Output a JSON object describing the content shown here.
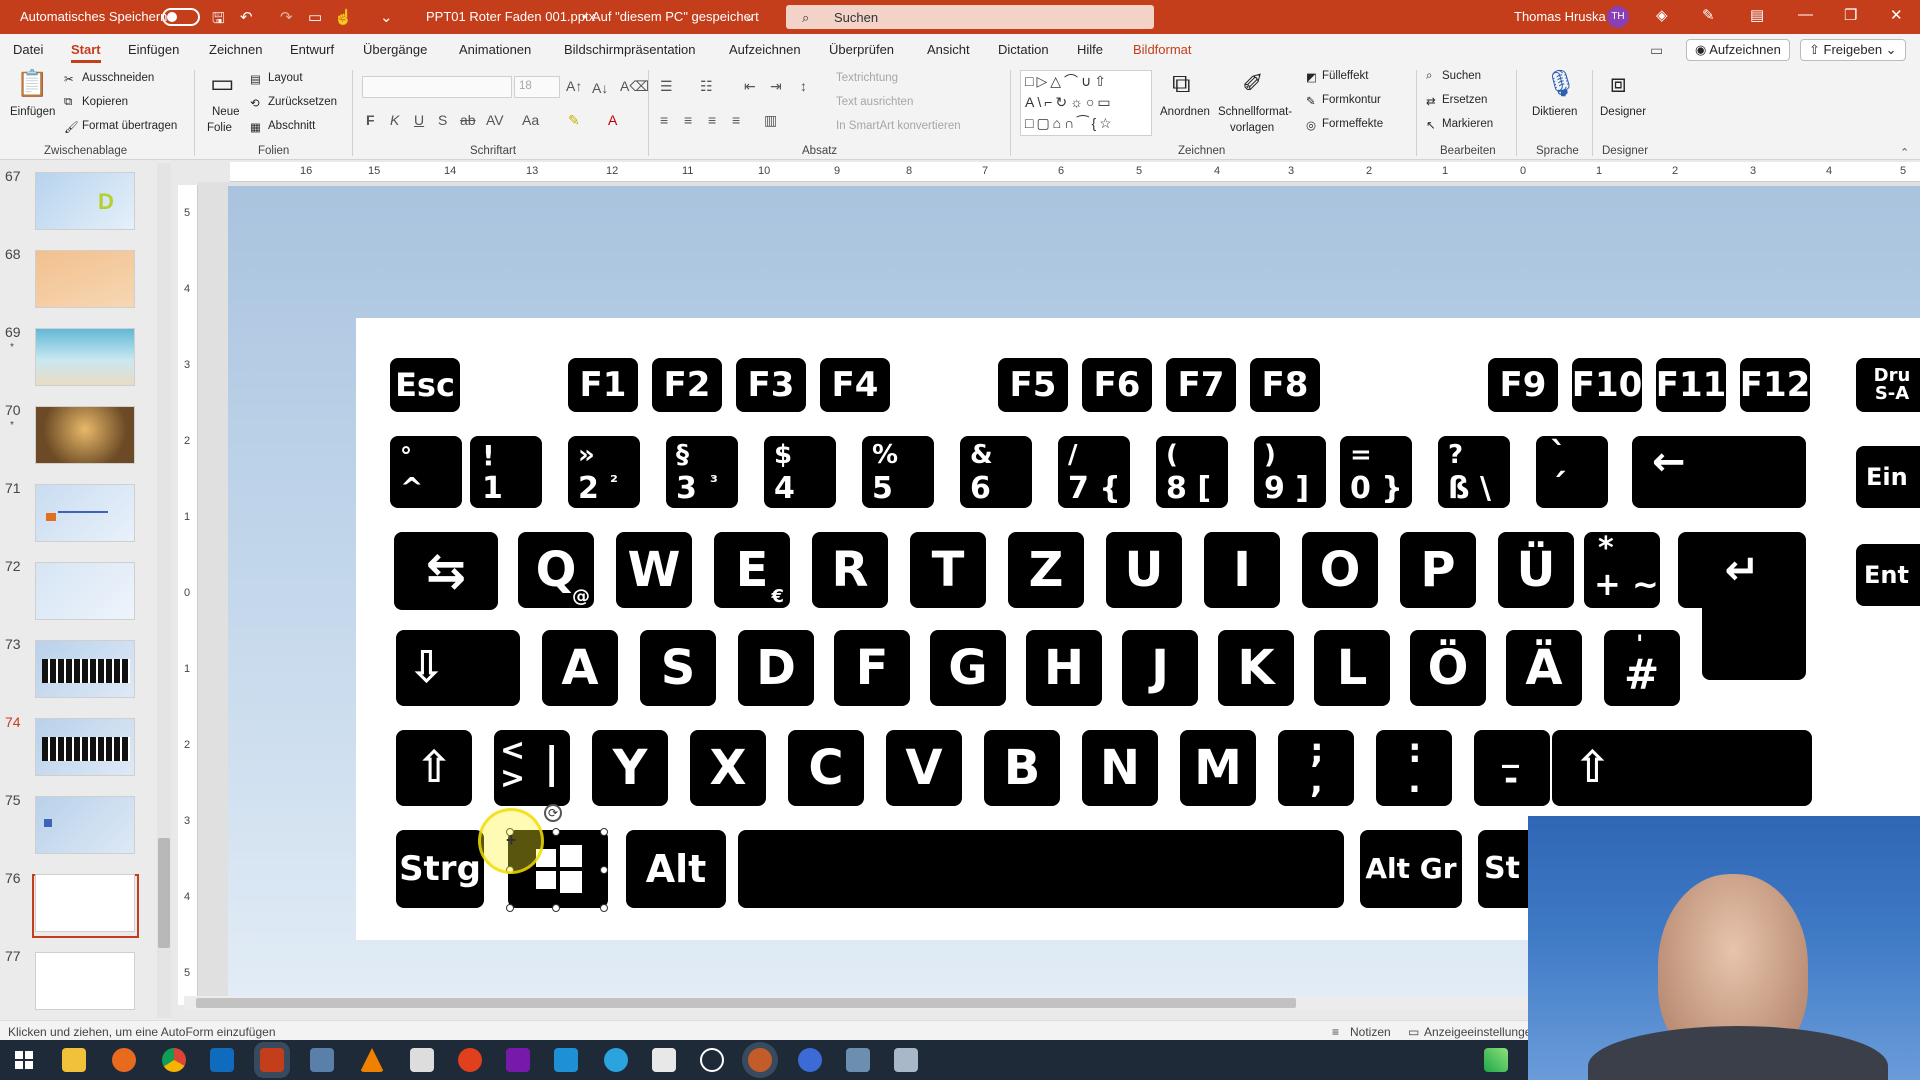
{
  "titlebar": {
    "autosave_label": "Automatisches Speichern",
    "document_title": "PPT01 Roter Faden 001.pptx",
    "save_location": "Auf \"diesem PC\" gespeichert",
    "search_placeholder": "Suchen",
    "user_name": "Thomas Hruska",
    "user_initials": "TH"
  },
  "menu": {
    "tabs": [
      "Datei",
      "Start",
      "Einfügen",
      "Zeichnen",
      "Entwurf",
      "Übergänge",
      "Animationen",
      "Bildschirmpräsentation",
      "Aufzeichnen",
      "Überprüfen",
      "Ansicht",
      "Dictation",
      "Hilfe",
      "Bildformat"
    ],
    "active_tab": "Start",
    "record_button": "Aufzeichnen",
    "share_button": "Freigeben"
  },
  "ribbon": {
    "zwischenablage": {
      "paste": "Einfügen",
      "cut": "Ausschneiden",
      "copy": "Kopieren",
      "format_painter": "Format übertragen",
      "group": "Zwischenablage"
    },
    "folien": {
      "new_slide_1": "Neue",
      "new_slide_2": "Folie",
      "layout": "Layout",
      "reset": "Zurücksetzen",
      "section": "Abschnitt",
      "group": "Folien"
    },
    "schriftart": {
      "font_size": "18",
      "group": "Schriftart"
    },
    "absatz": {
      "text_direction": "Textrichtung",
      "align_text": "Text ausrichten",
      "smartart": "In SmartArt konvertieren",
      "group": "Absatz"
    },
    "zeichnen": {
      "arrange": "Anordnen",
      "quick_styles_1": "Schnellformat-",
      "quick_styles_2": "vorlagen",
      "fill": "Fülleffekt",
      "outline": "Formkontur",
      "effects": "Formeffekte",
      "group": "Zeichnen"
    },
    "bearbeiten": {
      "find": "Suchen",
      "replace": "Ersetzen",
      "select": "Markieren",
      "group": "Bearbeiten"
    },
    "sprache": {
      "dictate": "Diktieren",
      "group": "Sprache"
    },
    "designer": {
      "designer": "Designer",
      "group": "Designer"
    }
  },
  "slides": {
    "numbers": [
      "67",
      "68",
      "69",
      "70",
      "71",
      "72",
      "73",
      "74",
      "75",
      "76",
      "77"
    ],
    "current": "74",
    "hidden_marker": "*"
  },
  "ruler": {
    "horizontal": [
      "16",
      "15",
      "14",
      "13",
      "12",
      "11",
      "10",
      "9",
      "8",
      "7",
      "6",
      "5",
      "4",
      "3",
      "2",
      "1",
      "0",
      "1",
      "2",
      "3",
      "4",
      "5"
    ],
    "vertical": [
      "5",
      "4",
      "3",
      "2",
      "1",
      "0",
      "1",
      "2",
      "3",
      "4",
      "5"
    ]
  },
  "keyboard": {
    "fn_row": [
      "Esc",
      "F1",
      "F2",
      "F3",
      "F4",
      "F5",
      "F6",
      "F7",
      "F8",
      "F9",
      "F10",
      "F11",
      "F12",
      "Dru S-A"
    ],
    "number_row": [
      {
        "top": "°",
        "bottom": "^"
      },
      {
        "top": "!",
        "bottom": "1"
      },
      {
        "top": "»",
        "bottom": "2",
        "alt": "²"
      },
      {
        "top": "§",
        "bottom": "3",
        "alt": "³"
      },
      {
        "top": "$",
        "bottom": "4"
      },
      {
        "top": "%",
        "bottom": "5"
      },
      {
        "top": "&",
        "bottom": "6"
      },
      {
        "top": "/",
        "bottom": "7 {"
      },
      {
        "top": "(",
        "bottom": "8 ["
      },
      {
        "top": ")",
        "bottom": "9 ]"
      },
      {
        "top": "=",
        "bottom": "0 }"
      },
      {
        "top": "?",
        "bottom": "ß \\"
      },
      {
        "top": "`",
        "bottom": "´"
      }
    ],
    "backspace": "←",
    "insert": "Ein",
    "q_row": [
      "Q",
      "W",
      "E",
      "R",
      "T",
      "Z",
      "U",
      "I",
      "O",
      "P",
      "Ü"
    ],
    "q_alt": "@",
    "e_alt": "€",
    "plus_key": {
      "top": "*",
      "bottom": "+ ~"
    },
    "enter": "↵",
    "ent_side": "Ent",
    "tab": "⇆",
    "a_row": [
      "A",
      "S",
      "D",
      "F",
      "G",
      "H",
      "J",
      "K",
      "L",
      "Ö",
      "Ä"
    ],
    "hash_key": {
      "top": "'",
      "bottom": "#"
    },
    "caps": "⇩",
    "z_row": [
      "Y",
      "X",
      "C",
      "V",
      "B",
      "N",
      "M"
    ],
    "angle_key": {
      "top": "<",
      "bottom": ">",
      "alt": "|"
    },
    "semicolon_key": {
      "top": ";",
      "bottom": ","
    },
    "colon_key": {
      "top": ":",
      "bottom": "."
    },
    "underscore_key": {
      "top": "_",
      "bottom": "-"
    },
    "shift": "⇧",
    "ctrl": "Strg",
    "alt": "Alt",
    "altgr": "Alt Gr",
    "right_partial": "St"
  },
  "statusbar": {
    "hint": "Klicken und ziehen, um eine AutoForm einzufügen",
    "notes": "Notizen",
    "display_settings": "Anzeigeeinstellunge"
  },
  "colors": {
    "accent": "#c43e1c",
    "taskbar": "#1e2a38"
  }
}
